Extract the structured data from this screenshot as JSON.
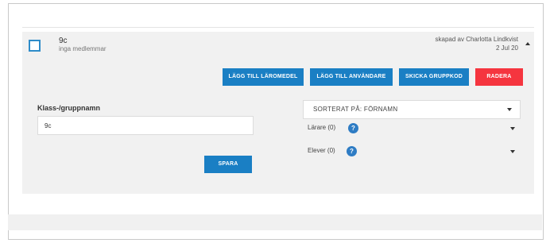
{
  "group": {
    "name": "9c",
    "members_text": "inga medlemmar",
    "created_by": "skapad av Charlotta Lindkvist",
    "created_date": "2 Jul 20"
  },
  "actions": {
    "add_material": "LÄGG TILL LÄROMEDEL",
    "add_user": "LÄGG TILL ANVÄNDARE",
    "send_code": "SKICKA GRUPPKOD",
    "delete": "RADERA"
  },
  "form": {
    "label": "Klass-/gruppnamn",
    "value": "9c",
    "save": "SPARA"
  },
  "sort": {
    "label": "SORTERAT PÅ:  FÖRNAMN"
  },
  "sections": {
    "teachers": "Lärare (0)",
    "students": "Elever (0)",
    "help_glyph": "?"
  },
  "colors": {
    "primary": "#1a7fc4",
    "danger": "#f5353f",
    "card_bg": "#f1f1f1"
  },
  "icons": [
    "checkbox-icon",
    "chevron-up-icon",
    "chevron-down-icon",
    "help-icon"
  ]
}
